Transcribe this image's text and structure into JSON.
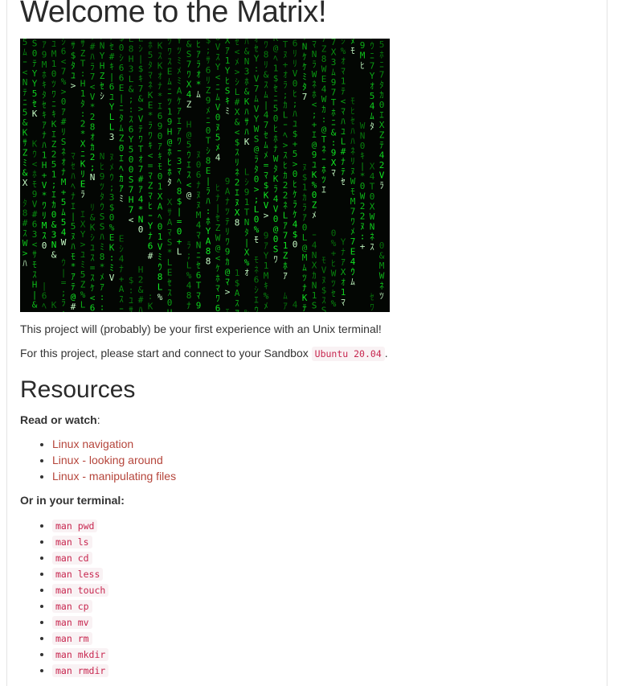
{
  "page": {
    "title": "Welcome to the Matrix!",
    "intro": "This project will (probably) be your first experience with an Unix terminal!",
    "sandbox_prefix": "For this project, please start and connect to your Sandbox ",
    "sandbox_code": "Ubuntu 20.04",
    "sandbox_suffix": "."
  },
  "resources": {
    "heading": "Resources",
    "read_label": "Read or watch",
    "read_colon": ":",
    "links": [
      {
        "label": "Linux navigation"
      },
      {
        "label": "Linux - looking around"
      },
      {
        "label": "Linux - manipulating files"
      }
    ],
    "terminal_label": "Or in your terminal:",
    "commands": [
      "man pwd",
      "man ls",
      "man cd",
      "man less",
      "man touch",
      "man cp",
      "man mv",
      "man rm",
      "man mkdir",
      "man rmdir"
    ]
  },
  "colors": {
    "link": "#b5453b",
    "code_text": "#c7254e",
    "code_bg": "#f9f2f4",
    "matrix_green": "#39d353"
  },
  "icons": {
    "banner": "matrix-digital-rain-image"
  }
}
